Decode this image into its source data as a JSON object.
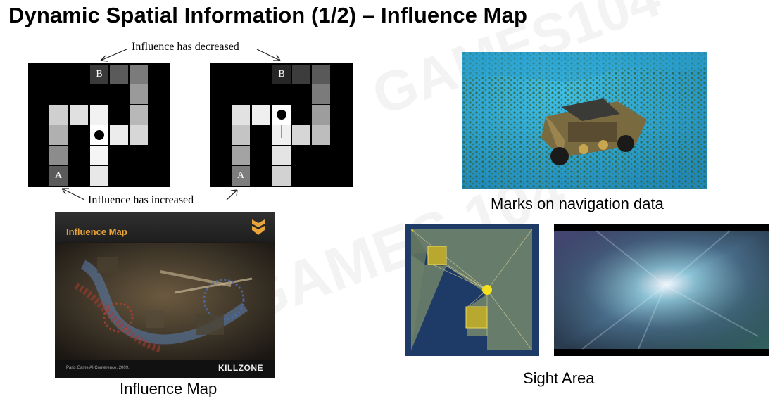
{
  "slide": {
    "title": "Dynamic Spatial Information (1/2) – Influence Map"
  },
  "influence_diagram": {
    "top_annotation": "Influence has decreased",
    "bottom_annotation": "Influence has increased",
    "label_a": "A",
    "label_b": "B"
  },
  "killzone_image": {
    "header_title": "Influence Map",
    "footer_credit": "Paris Game AI Conference, 2009.",
    "footer_logo": "KILLZONE",
    "logo_icon": "chevron-shield-icon",
    "accent_color": "#e8a33a"
  },
  "captions": {
    "influence_map": "Influence Map",
    "navigation": "Marks on navigation data",
    "sight_area": "Sight Area"
  },
  "watermark": {
    "text_1": "GAMES104",
    "text_2": "GAMES 104"
  }
}
